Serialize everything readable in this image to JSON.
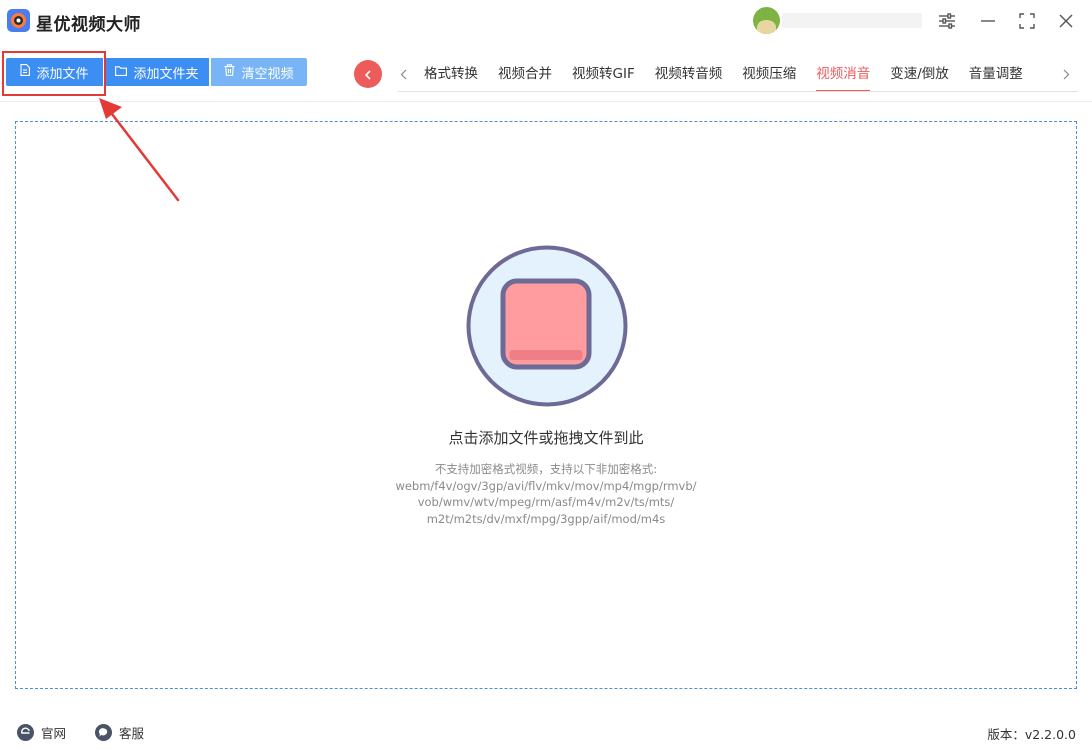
{
  "app": {
    "title": "星优视频大师"
  },
  "toolbar": {
    "add_file": "添加文件",
    "add_folder": "添加文件夹",
    "clear_videos": "清空视频"
  },
  "tabs": [
    {
      "label": "格式转换",
      "active": false
    },
    {
      "label": "视频合并",
      "active": false
    },
    {
      "label": "视频转GIF",
      "active": false
    },
    {
      "label": "视频转音频",
      "active": false
    },
    {
      "label": "视频压缩",
      "active": false
    },
    {
      "label": "视频消音",
      "active": true
    },
    {
      "label": "变速/倒放",
      "active": false
    },
    {
      "label": "音量调整",
      "active": false
    }
  ],
  "dropzone": {
    "title": "点击添加文件或拖拽文件到此",
    "formats_line1": "不支持加密格式视频，支持以下非加密格式:",
    "formats_line2": "webm/f4v/ogv/3gp/avi/flv/mkv/mov/mp4/mgp/rmvb/",
    "formats_line3": "vob/wmv/wtv/mpeg/rm/asf/m4v/m2v/ts/mts/",
    "formats_line4": "m2t/m2ts/dv/mxf/mpg/3gpp/aif/mod/m4s"
  },
  "footer": {
    "website": "官网",
    "support": "客服",
    "version": "版本：v2.2.0.0"
  },
  "colors": {
    "primary_blue": "#3d8ef2",
    "light_blue": "#78b4f6",
    "accent_red": "#ee5b5b",
    "annotation_red": "#e53935",
    "dropzone_border": "#4a90d9"
  }
}
